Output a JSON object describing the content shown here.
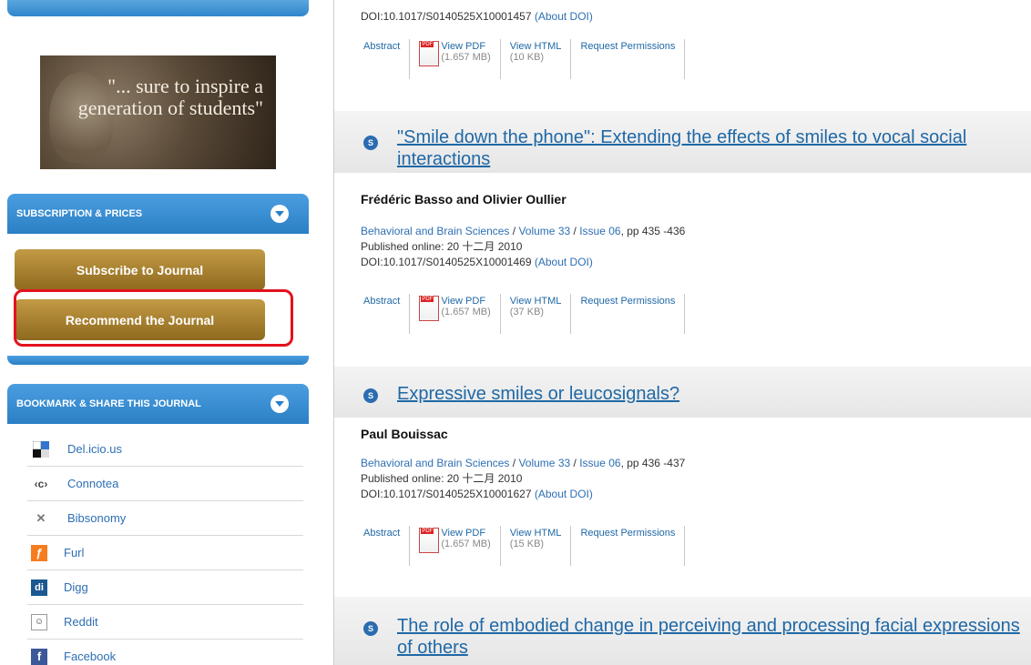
{
  "sidebar": {
    "promo_quote": "\"... sure to inspire a generation of students\"",
    "subscription": {
      "header": "SUBSCRIPTION & PRICES",
      "subscribe_label": "Subscribe to Journal",
      "recommend_label": "Recommend the Journal"
    },
    "share": {
      "header": "BOOKMARK & SHARE THIS JOURNAL",
      "items": [
        {
          "label": "Del.icio.us",
          "icon": "delicious-icon"
        },
        {
          "label": "Connotea",
          "icon": "connotea-icon"
        },
        {
          "label": "Bibsonomy",
          "icon": "bibsonomy-icon"
        },
        {
          "label": "Furl",
          "icon": "furl-icon"
        },
        {
          "label": "Digg",
          "icon": "digg-icon"
        },
        {
          "label": "Reddit",
          "icon": "reddit-icon"
        },
        {
          "label": "Facebook",
          "icon": "facebook-icon"
        }
      ]
    }
  },
  "articles": [
    {
      "doi_prefix": "DOI:10.1017/S0140525X10001457",
      "about_doi": "(About DOI)",
      "actions": {
        "abstract": "Abstract",
        "view_pdf": "View PDF",
        "pdf_size": "(1.657 MB)",
        "view_html": "View HTML",
        "html_size": "(10 KB)",
        "permissions": "Request Permissions"
      }
    },
    {
      "bullet": "S",
      "title": "\"Smile down the phone\": Extending the effects of smiles to vocal social interactions",
      "authors": "Frédéric Basso and Olivier Oullier",
      "journal": "Behavioral and Brain Sciences",
      "volume": "Volume 33",
      "issue": "Issue 06",
      "pages": ", pp 435 -436",
      "published": "Published online: 20 十二月 2010",
      "doi": "DOI:10.1017/S0140525X10001469",
      "about_doi": "(About DOI)",
      "actions": {
        "abstract": "Abstract",
        "view_pdf": "View PDF",
        "pdf_size": "(1.657 MB)",
        "view_html": "View HTML",
        "html_size": "(37 KB)",
        "permissions": "Request Permissions"
      }
    },
    {
      "bullet": "S",
      "title": "Expressive smiles or leucosignals?",
      "authors": "Paul Bouissac",
      "journal": "Behavioral and Brain Sciences",
      "volume": "Volume 33",
      "issue": "Issue 06",
      "pages": ", pp 436 -437",
      "published": "Published online: 20 十二月 2010",
      "doi": "DOI:10.1017/S0140525X10001627",
      "about_doi": "(About DOI)",
      "actions": {
        "abstract": "Abstract",
        "view_pdf": "View PDF",
        "pdf_size": "(1.657 MB)",
        "view_html": "View HTML",
        "html_size": "(15 KB)",
        "permissions": "Request Permissions"
      }
    },
    {
      "bullet": "S",
      "title": "The role of embodied change in perceiving and processing facial expressions of others"
    }
  ]
}
